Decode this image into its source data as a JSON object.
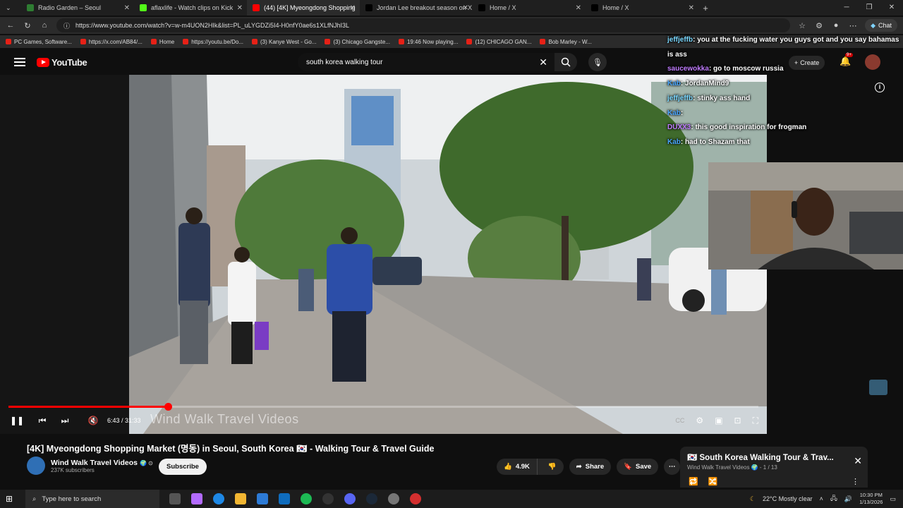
{
  "browser": {
    "tabs": [
      {
        "title": "Radio Garden – Seoul",
        "color": "#2e7d32"
      },
      {
        "title": "aflaxlife - Watch clips on Kick",
        "color": "#53fc18"
      },
      {
        "title": "(44) [4K] Myeongdong Shopping",
        "color": "#ff0000",
        "active": true
      },
      {
        "title": "Jordan Lee breakout season on X",
        "color": "#000000"
      },
      {
        "title": "Home / X",
        "color": "#000000"
      },
      {
        "title": "Home / X",
        "color": "#000000"
      }
    ],
    "new_tab": "+",
    "url": "https://www.youtube.com/watch?v=w-m4UON2HIk&list=PL_uLYGDZi5I4-H0nfY0ae6s1XLfNJhI3L",
    "chat_label": "Chat",
    "bookmarks": [
      "PC Games, Software...",
      "https://x.com/AB84/...",
      "Home",
      "https://youtu.be/Do...",
      "(3) Kanye West - Go...",
      "(3) Chicago Gangste...",
      "19:46 Now playing...",
      "(12) CHICAGO GAN...",
      "Bob Marley - W..."
    ]
  },
  "youtube": {
    "logo_text": "YouTube",
    "search_value": "south korea walking tour",
    "create_label": "Create",
    "notification_badge": "9+"
  },
  "stream_chat": [
    {
      "user": "jeffjeffb",
      "msg": "you at the fucking water you guys got and you say bahamas is ass",
      "cls": "u2"
    },
    {
      "user": "saucewokka",
      "msg": "go to moscow russia",
      "cls": "u3"
    },
    {
      "user": "Kab",
      "msg": "JordanMind9",
      "cls": "u"
    },
    {
      "user": "jeffjeffb",
      "msg": "stinky ass hand",
      "cls": "u2"
    },
    {
      "user": "Kab",
      "msg": "",
      "cls": "u"
    },
    {
      "user": "DUXX3",
      "msg": "this good inspiration for frogman",
      "cls": "u3"
    },
    {
      "user": "Kab",
      "msg": "had to Shazam that",
      "cls": "u"
    }
  ],
  "player": {
    "watermark": "Wind Walk Travel Videos",
    "time": "6:43 / 31:33",
    "progress": 0.213
  },
  "video": {
    "title": "[4K] Myeongdong Shopping Market (명동) in Seoul, South Korea 🇰🇷 - Walking Tour & Travel Guide",
    "channel": "Wind Walk Travel Videos",
    "channel_badge": "🌍 ⊙",
    "subscribers": "237K subscribers",
    "subscribe_label": "Subscribe",
    "likes": "4.9K",
    "share_label": "Share",
    "save_label": "Save"
  },
  "playlist": {
    "title": "🇰🇷 South Korea Walking Tour & Trav...",
    "subtitle": "Wind Walk Travel Videos 🌍 - 1 / 13"
  },
  "taskbar": {
    "search_placeholder": "Type here to search",
    "weather": "22°C  Mostly clear",
    "time": "10:30 PM",
    "date": "1/13/2026"
  }
}
